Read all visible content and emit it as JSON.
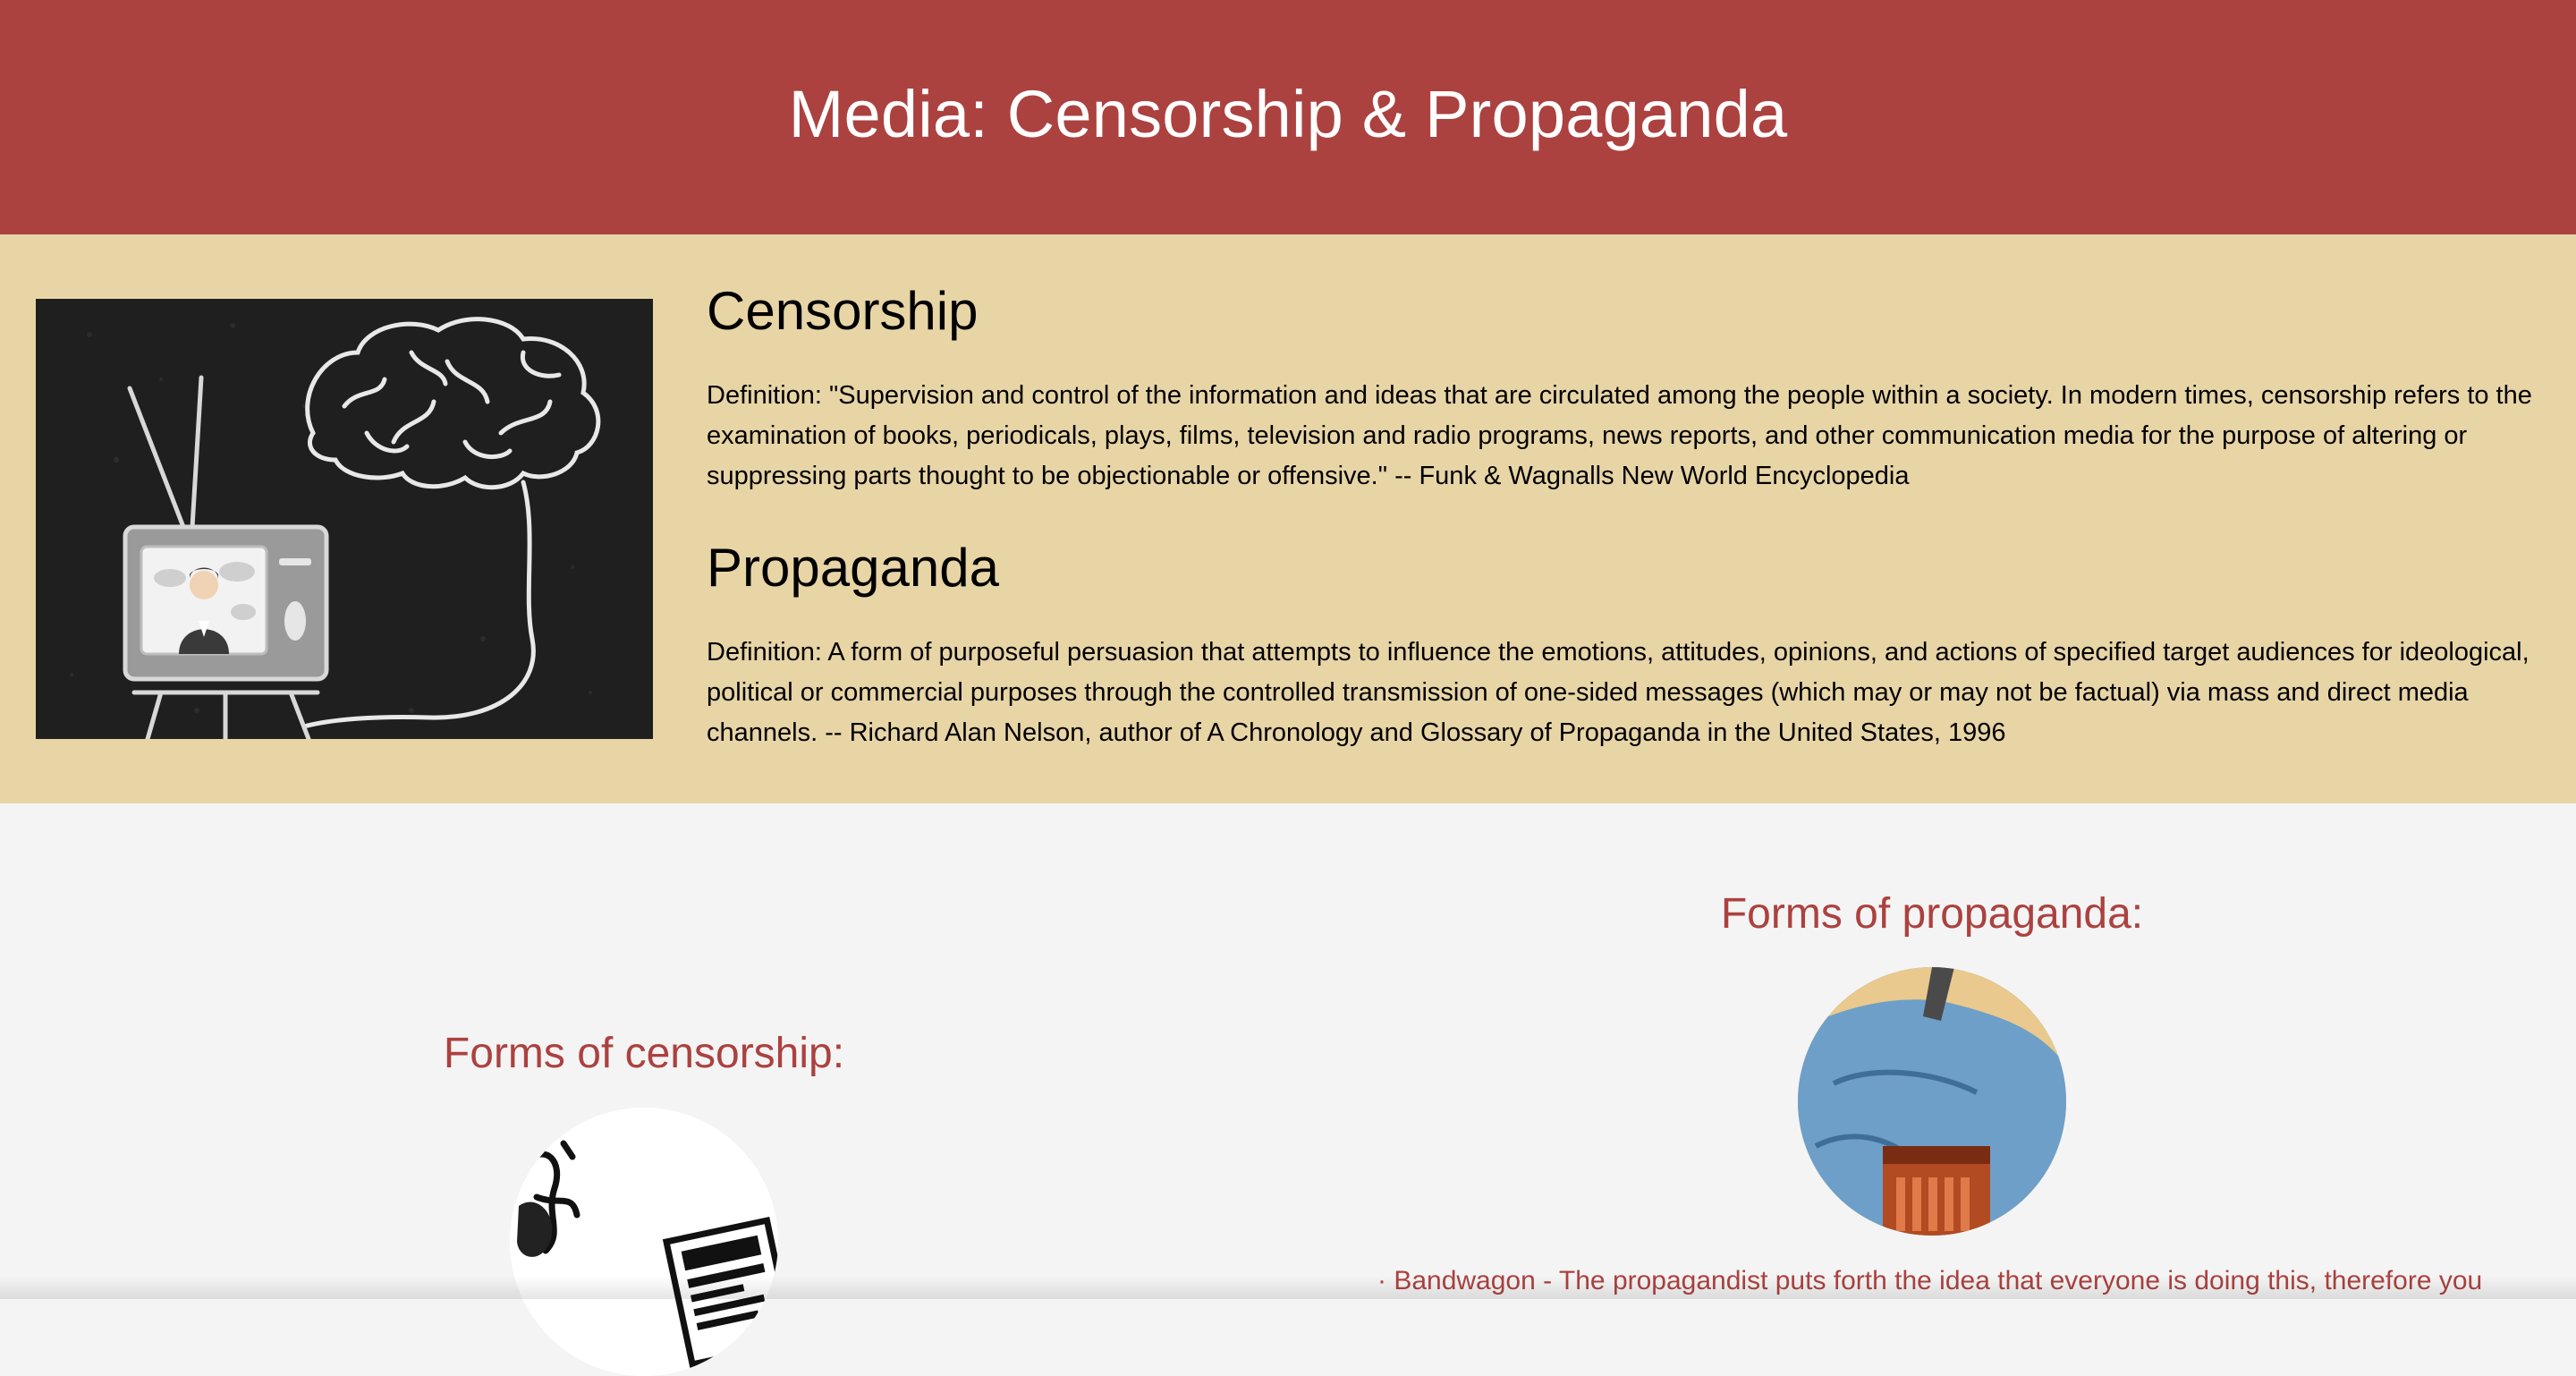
{
  "header": {
    "title": "Media: Censorship & Propaganda"
  },
  "intro": {
    "image_icon": "tv-brain-illustration-icon",
    "censorship": {
      "heading": "Censorship",
      "definition": "Definition: \"Supervision and control of the information and ideas that are circulated among the people within a society. In modern times, censorship refers to the examination of books, periodicals, plays, films, television and radio programs, news reports, and other communication media for the purpose of altering or suppressing parts thought to be objectionable or offensive.\" -- Funk & Wagnalls New World Encyclopedia"
    },
    "propaganda": {
      "heading": "Propaganda",
      "definition": "Definition: A form of purposeful persuasion that attempts to influence the emotions, attitudes, opinions, and actions of specified target audiences for ideological, political or commercial purposes through the controlled transmission of one-sided messages (which may or may not be factual) via mass and direct media channels. -- Richard Alan Nelson, author of A Chronology and Glossary of Propaganda in the United States, 1996"
    }
  },
  "forms": {
    "censorship": {
      "heading": "Forms of censorship:",
      "image_icon": "censorship-cartoon-icon"
    },
    "propaganda": {
      "heading": "Forms of propaganda:",
      "image_icon": "propaganda-cartoon-icon",
      "items": [
        "Bandwagon - The propagandist puts forth the idea that everyone is doing this, therefore you"
      ]
    }
  },
  "colors": {
    "header_bg": "#ab4240",
    "intro_bg": "#e8d5a6",
    "page_bg": "#f4f4f4",
    "accent_text": "#ab4240"
  }
}
